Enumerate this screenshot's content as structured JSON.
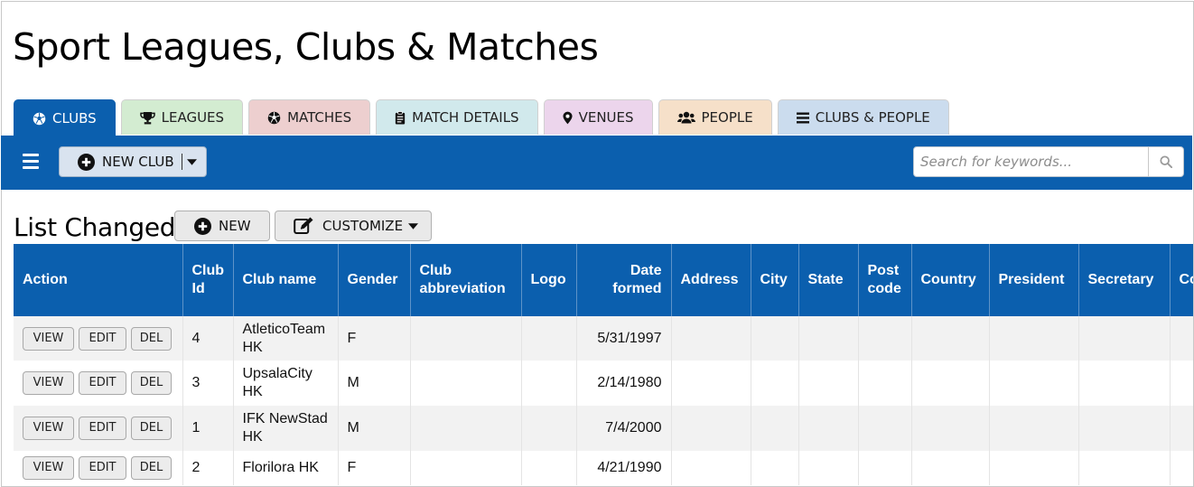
{
  "page": {
    "title": "Sport Leagues, Clubs & Matches"
  },
  "tabs": [
    {
      "label": "CLUBS",
      "icon": "soccer-ball-icon",
      "bg": "#0b5fae",
      "active": true
    },
    {
      "label": "LEAGUES",
      "icon": "trophy-icon",
      "bg": "#d3ecd1",
      "active": false
    },
    {
      "label": "MATCHES",
      "icon": "soccer-ball-icon",
      "bg": "#edcfcf",
      "active": false
    },
    {
      "label": "MATCH DETAILS",
      "icon": "clipboard-icon",
      "bg": "#d1e9ec",
      "active": false
    },
    {
      "label": "VENUES",
      "icon": "map-marker-icon",
      "bg": "#ecd5ec",
      "active": false
    },
    {
      "label": "PEOPLE",
      "icon": "users-icon",
      "bg": "#f6e0c9",
      "active": false
    },
    {
      "label": "CLUBS & PEOPLE",
      "icon": "list-icon",
      "bg": "#cbdcee",
      "active": false
    }
  ],
  "toolbar": {
    "new_club_label": "NEW CLUB",
    "search_placeholder": "Search for keywords...",
    "search_value": ""
  },
  "list": {
    "title": "List Changed",
    "new_label": "NEW",
    "customize_label": "CUSTOMIZE"
  },
  "table": {
    "columns": [
      {
        "key": "action",
        "label": "Action",
        "align": "left"
      },
      {
        "key": "club_id",
        "label": "Club Id",
        "align": "left"
      },
      {
        "key": "club_name",
        "label": "Club name",
        "align": "left"
      },
      {
        "key": "gender",
        "label": "Gender",
        "align": "left"
      },
      {
        "key": "abbr",
        "label": "Club abbreviation",
        "align": "left"
      },
      {
        "key": "logo",
        "label": "Logo",
        "align": "left"
      },
      {
        "key": "date_formed",
        "label": "Date formed",
        "align": "right"
      },
      {
        "key": "address",
        "label": "Address",
        "align": "left"
      },
      {
        "key": "city",
        "label": "City",
        "align": "left"
      },
      {
        "key": "state",
        "label": "State",
        "align": "left"
      },
      {
        "key": "post_code",
        "label": "Post code",
        "align": "left"
      },
      {
        "key": "country",
        "label": "Country",
        "align": "left"
      },
      {
        "key": "president",
        "label": "President",
        "align": "left"
      },
      {
        "key": "secretary",
        "label": "Secretary",
        "align": "left"
      },
      {
        "key": "more",
        "label": "Co",
        "align": "left"
      }
    ],
    "action_labels": {
      "view": "VIEW",
      "edit": "EDIT",
      "del": "DEL"
    },
    "rows": [
      {
        "club_id": "4",
        "club_name": "AtleticoTeam HK",
        "gender": "F",
        "abbr": "",
        "logo": "",
        "date_formed": "5/31/1997",
        "address": "",
        "city": "",
        "state": "",
        "post_code": "",
        "country": "",
        "president": "",
        "secretary": "",
        "more": ""
      },
      {
        "club_id": "3",
        "club_name": "UpsalaCity HK",
        "gender": "M",
        "abbr": "",
        "logo": "",
        "date_formed": "2/14/1980",
        "address": "",
        "city": "",
        "state": "",
        "post_code": "",
        "country": "",
        "president": "",
        "secretary": "",
        "more": ""
      },
      {
        "club_id": "1",
        "club_name": "IFK NewStad HK",
        "gender": "M",
        "abbr": "",
        "logo": "",
        "date_formed": "7/4/2000",
        "address": "",
        "city": "",
        "state": "",
        "post_code": "",
        "country": "",
        "president": "",
        "secretary": "",
        "more": ""
      },
      {
        "club_id": "2",
        "club_name": "Florilora HK",
        "gender": "F",
        "abbr": "",
        "logo": "",
        "date_formed": "4/21/1990",
        "address": "",
        "city": "",
        "state": "",
        "post_code": "",
        "country": "",
        "president": "",
        "secretary": "",
        "more": ""
      }
    ]
  },
  "colors": {
    "brand": "#0b5fae",
    "row_alt": "#f2f2f2"
  }
}
